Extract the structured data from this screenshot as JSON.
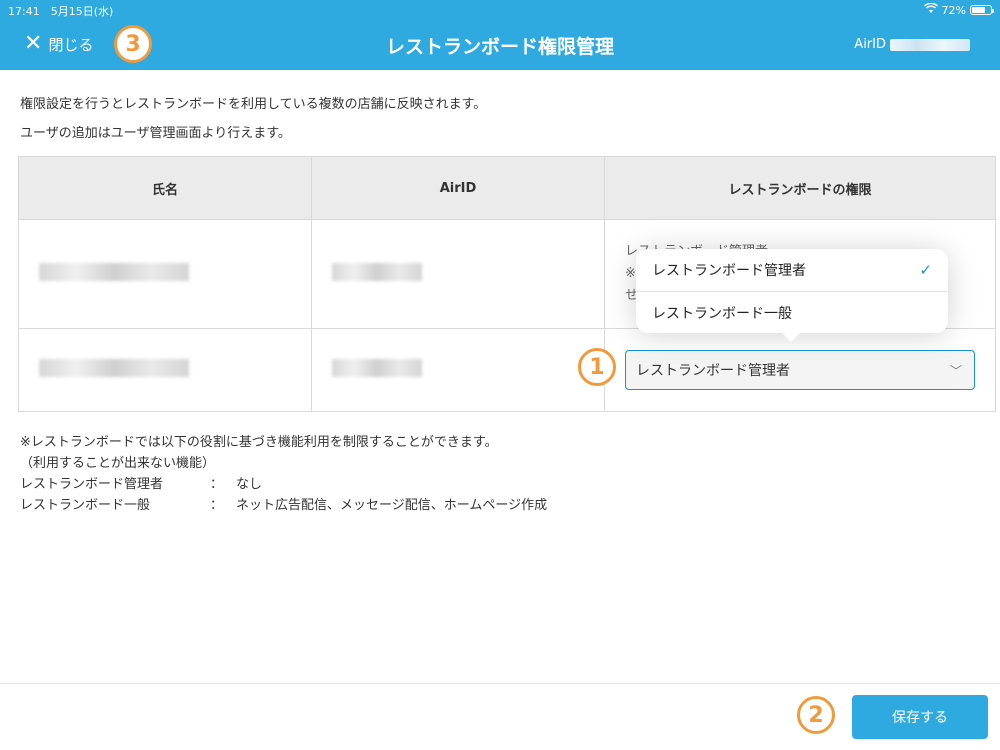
{
  "status": {
    "time": "17:41",
    "date": "5月15日(水)",
    "battery": "72%",
    "battery_level": 0.72,
    "wifi_icon": "wifi-icon"
  },
  "nav": {
    "close_label": "閉じる",
    "title": "レストランボード権限管理",
    "airid_label": "AirID"
  },
  "intro": {
    "line1": "権限設定を行うとレストランボードを利用している複数の店舗に反映されます。",
    "line2": "ユーザの追加はユーザ管理画面より行えます。"
  },
  "table": {
    "headers": [
      "氏名",
      "AirID",
      "レストランボードの権限"
    ],
    "row1_role_line1": "レストランボード管理者",
    "row1_role_line2_prefix": "※",
    "row1_role_line3_prefix": "せ",
    "row2_selected": "レストランボード管理者"
  },
  "popover": {
    "options": [
      "レストランボード管理者",
      "レストランボード一般"
    ],
    "checked_icon": "checkmark-icon"
  },
  "note": {
    "line1": "※レストランボードでは以下の役割に基づき機能利用を制限することができます。",
    "line2": "（利用することが出来ない機能）",
    "admin_label": "レストランボード管理者",
    "admin_value": "なし",
    "general_label": "レストランボード一般",
    "general_value": "ネット広告配信、メッセージ配信、ホームページ作成",
    "separator": "："
  },
  "footer": {
    "save_label": "保存する"
  },
  "badges": {
    "b1": "1",
    "b2": "2",
    "b3": "3"
  },
  "colors": {
    "accent": "#2eaae1",
    "badge": "#f29a3b",
    "select_border": "#1e8fd6"
  }
}
